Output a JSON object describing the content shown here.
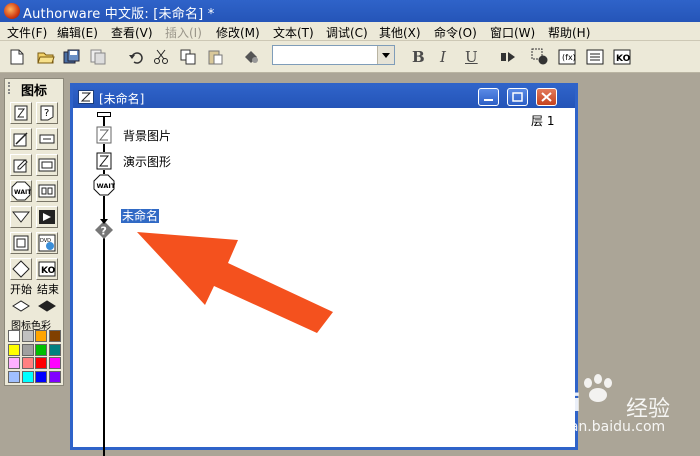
{
  "window": {
    "title": "Authorware 中文版: [未命名] *"
  },
  "menu": [
    {
      "label": "文件(F)",
      "enabled": true
    },
    {
      "label": "编辑(E)",
      "enabled": true
    },
    {
      "label": "查看(V)",
      "enabled": true
    },
    {
      "label": "插入(I)",
      "enabled": false
    },
    {
      "label": "修改(M)",
      "enabled": true
    },
    {
      "label": "文本(T)",
      "enabled": true
    },
    {
      "label": "调试(C)",
      "enabled": true
    },
    {
      "label": "其他(X)",
      "enabled": true
    },
    {
      "label": "命令(O)",
      "enabled": true
    },
    {
      "label": "窗口(W)",
      "enabled": true
    },
    {
      "label": "帮助(H)",
      "enabled": true
    }
  ],
  "toolbar": {
    "font_value": "",
    "bold": "B",
    "italic": "I",
    "underline": "U"
  },
  "palette": {
    "title": "图标",
    "start_label": "开始",
    "end_label": "结束",
    "color_label": "图标色彩",
    "colors": [
      "#ffffff",
      "#c0c0c0",
      "#ffa500",
      "#804000",
      "#ffff00",
      "#a0a0a0",
      "#00c000",
      "#008080",
      "#ffb0ff",
      "#ff8080",
      "#ff0000",
      "#ff00ff",
      "#a0c0ff",
      "#00ffff",
      "#0000ff",
      "#8000ff"
    ]
  },
  "flow_window": {
    "title": "[未命名]",
    "layer_label": "层 1",
    "items": [
      {
        "label": "背景图片",
        "icon": "display-icon"
      },
      {
        "label": "演示图形",
        "icon": "display-icon"
      },
      {
        "label": "",
        "icon": "wait-icon",
        "icon_text": "WAIT"
      },
      {
        "label": "未命名",
        "icon": "question-icon",
        "selected": true
      }
    ]
  },
  "watermark": {
    "brand": "Bai",
    "brand_cn": "经验",
    "url": "jingyan.baidu.com"
  },
  "colors": {
    "titlebar": "#2f63c9",
    "menubar": "#ece9d8",
    "selection": "#316ac5",
    "arrow": "#f4511e"
  }
}
